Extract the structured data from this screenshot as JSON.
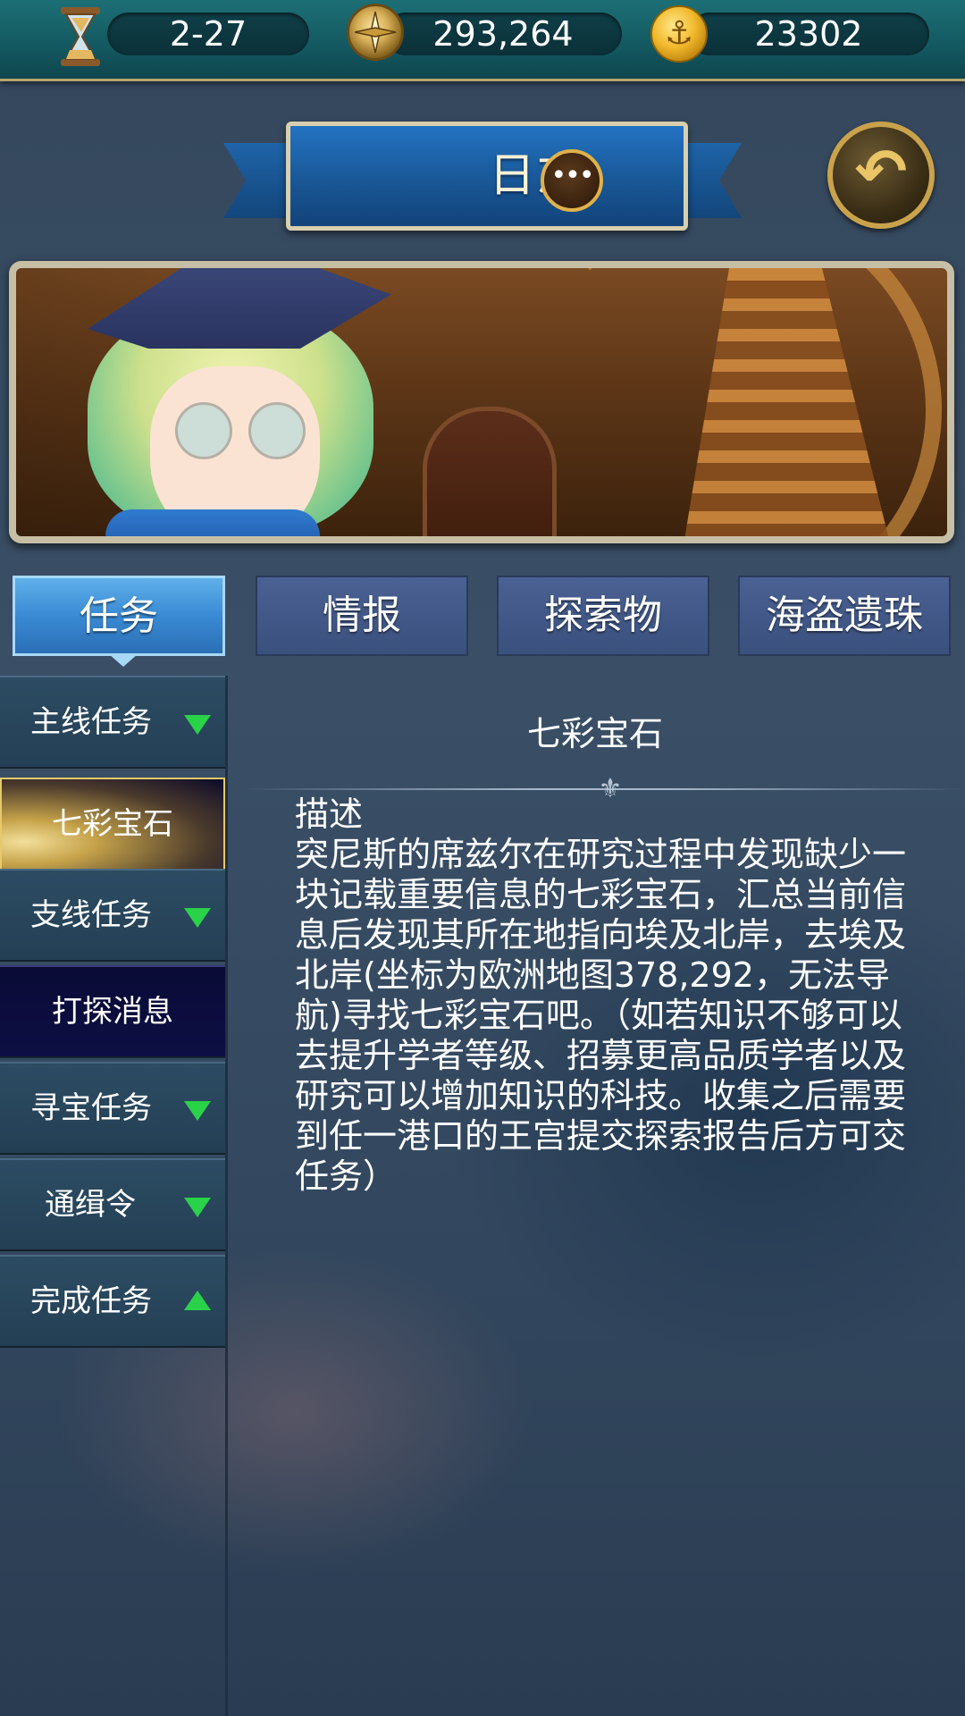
{
  "resources": {
    "date": "2-27",
    "compass_value": "293,264",
    "coins": "23302"
  },
  "header": {
    "title": "日志"
  },
  "tabs": [
    {
      "label": "任务",
      "active": true
    },
    {
      "label": "情报",
      "active": false
    },
    {
      "label": "探索物",
      "active": false
    },
    {
      "label": "海盗遗珠",
      "active": false
    }
  ],
  "sidebar": {
    "items": [
      {
        "label": "主线任务",
        "arrow": "down"
      },
      {
        "label": "七彩宝石",
        "selected": true
      },
      {
        "label": "支线任务",
        "arrow": "down"
      },
      {
        "label": "打探消息"
      },
      {
        "label": "寻宝任务",
        "arrow": "down"
      },
      {
        "label": "通缉令",
        "arrow": "down"
      },
      {
        "label": "完成任务",
        "arrow": "up"
      }
    ]
  },
  "quest": {
    "title": "七彩宝石",
    "description_label": "描述",
    "description": "突尼斯的席兹尔在研究过程中发现缺少一块记载重要信息的七彩宝石，汇总当前信息后发现其所在地指向埃及北岸，去埃及北岸(坐标为欧洲地图378,292，无法导航)寻找七彩宝石吧。（如若知识不够可以去提升学者等级、招募更高品质学者以及研究可以增加知识的科技。收集之后需要到任一港口的王宫提交探索报告后方可交任务）"
  },
  "icons": {
    "date": "hourglass-icon",
    "compass": "compass-icon",
    "coins": "anchor-coin-icon",
    "chat": "chat-bubble-icon",
    "back": "back-arrow-icon"
  },
  "colors": {
    "active_tab": "#3a8ad4",
    "arrow_green": "#2ad24a",
    "topbar": "#145a62"
  }
}
